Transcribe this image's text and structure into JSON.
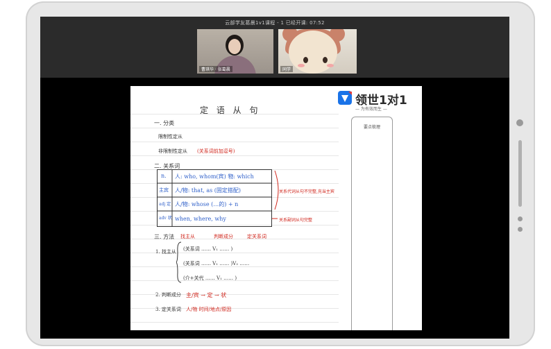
{
  "session": {
    "title": "云部学友葛晨1v1课程 - 1  已经开课: 07:52",
    "teacher_label": "曹琪华 · 张葛晨",
    "student_label": "同学"
  },
  "brand": {
    "name": "领世1对1",
    "slogan": "— 为有效而生 —"
  },
  "notes": {
    "title": "定 语 从 句",
    "side_panel_title": "要点梳理",
    "section1": "一. 分类",
    "restrictive": "限制性定从",
    "nonrestrictive": "非限制性定从",
    "nonrestrictive_note": "(关系词前加逗号)",
    "section2": "二. 关系词",
    "row1_tag": "n.",
    "row1_text": "人: who, whom(宾) 物: which",
    "row2_tag": "主宾",
    "row2_text": "人/物: that, as (固定搭配)",
    "row3_tag": "adj 定",
    "row3_text": "人/物: whose (…的) + n",
    "row4_tag": "adv 状",
    "row4_text": "when, where, why",
    "bracket_note1": "关系代词从句不完整,充当主宾",
    "bracket_note2": "关系副词从句完整",
    "section3": "三. 方法",
    "method1": "找主从",
    "method2": "判断成分",
    "method3": "定关系词",
    "step1": "1. 找主从",
    "step1a": "(关系词 …… V₁ …… )",
    "step1b": "(关系词 …… V₁ …… )V₂ ……",
    "step1c": "(介+关代 …… V₁ …… )",
    "step2": "2. 判断成分",
    "step2_text": "主/宾 → 定 → 状",
    "step3": "3. 定关系词",
    "step3_text": "人/物  时间/地点/原因"
  },
  "colors": {
    "accent_blue": "#2e5fc9",
    "accent_red": "#d0271d",
    "logo_blue": "#1a73e8",
    "logo_red": "#e53935"
  }
}
